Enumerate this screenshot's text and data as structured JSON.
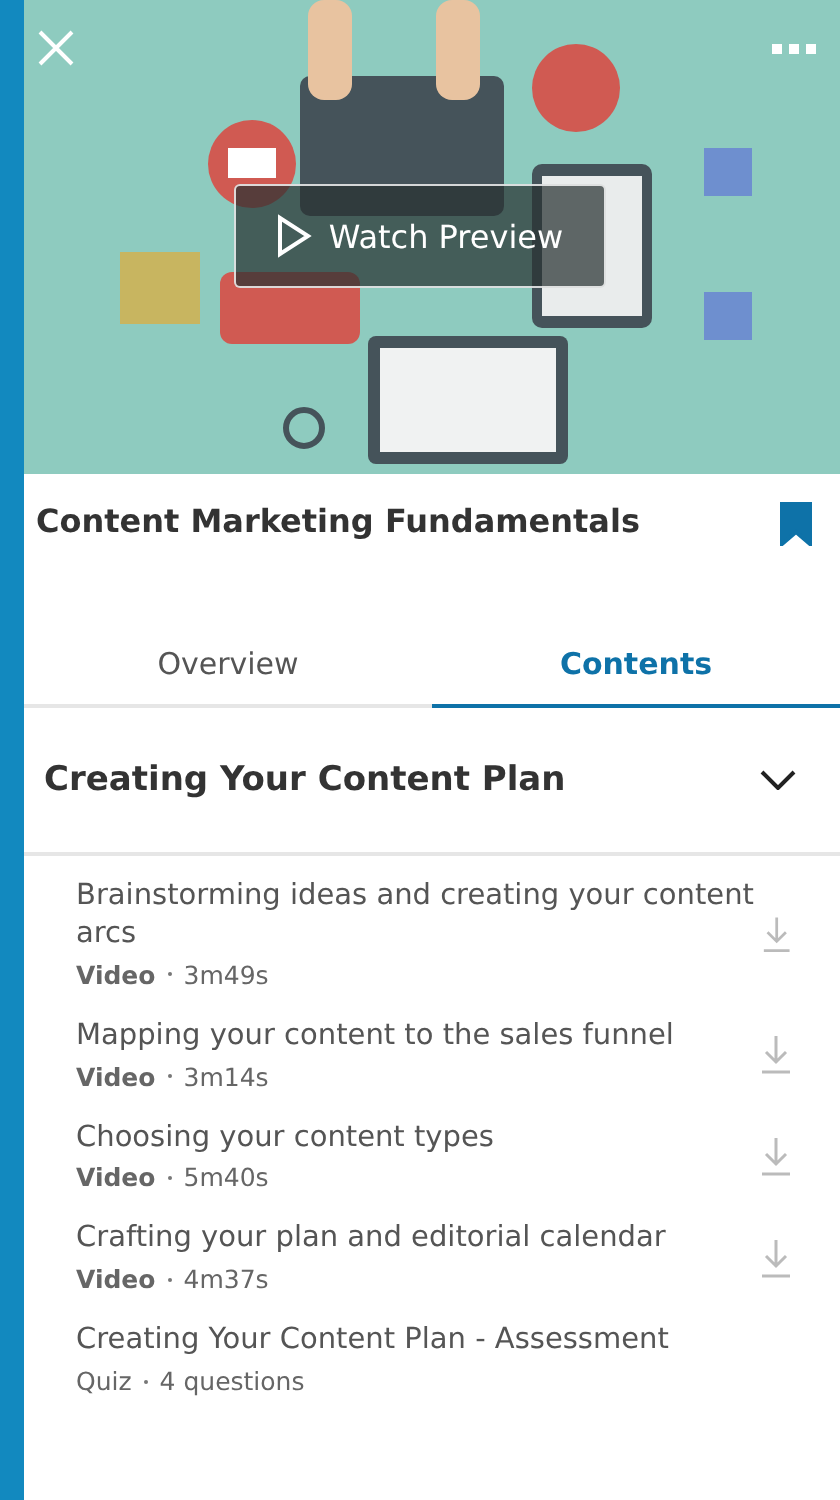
{
  "hero": {
    "button": "Watch Preview"
  },
  "course": {
    "title": "Content Marketing Fundamentals",
    "bookmarked": true
  },
  "tabs": [
    {
      "label": "Overview",
      "selected": false
    },
    {
      "label": "Contents",
      "selected": true
    }
  ],
  "section": {
    "title": "Creating Your Content Plan",
    "expanded": true
  },
  "items": [
    {
      "kind": "video",
      "title": "Brainstorming ideas and creating your content arcs",
      "type": "Video",
      "detail": "3m49s"
    },
    {
      "kind": "video",
      "title": "Mapping your content to the sales funnel",
      "type": "Video",
      "detail": "3m14s"
    },
    {
      "kind": "video",
      "title": "Choosing your content types",
      "type": "Video",
      "detail": "5m40s"
    },
    {
      "kind": "video",
      "title": "Crafting your plan and editorial calendar",
      "type": "Video",
      "detail": "4m37s"
    },
    {
      "kind": "quiz",
      "title": "Creating Your Content Plan - Assessment",
      "type": "Quiz",
      "detail": "4 questions"
    }
  ]
}
